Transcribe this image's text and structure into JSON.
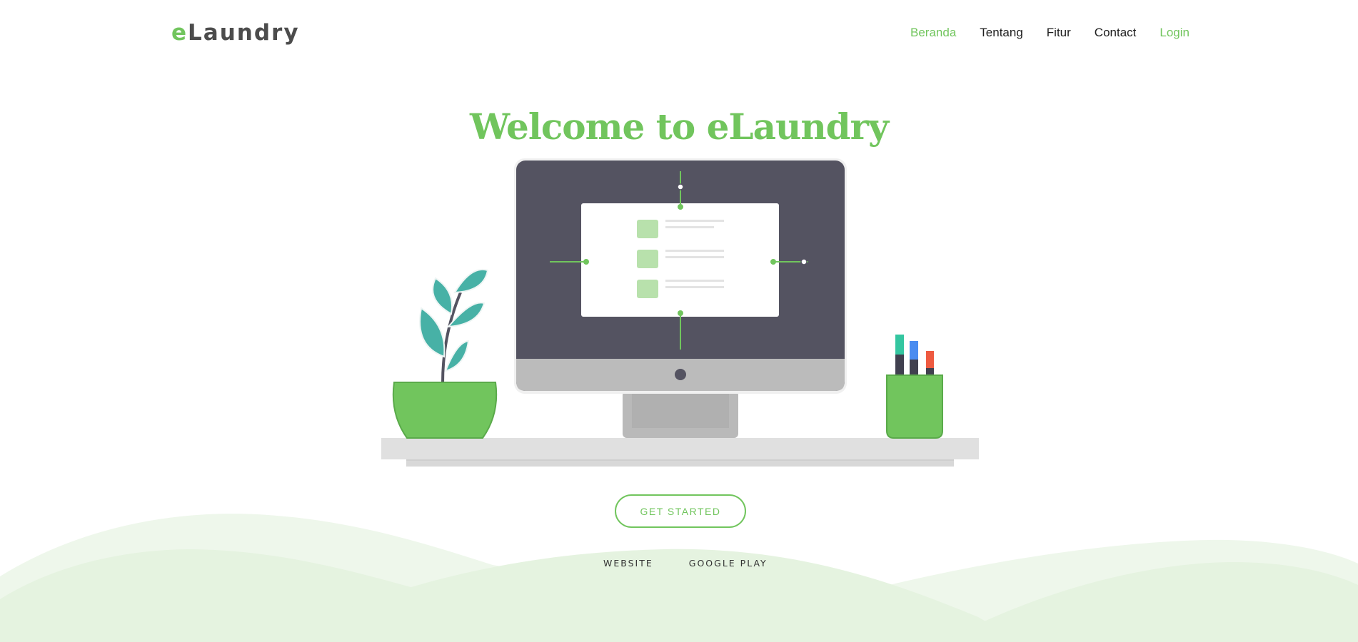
{
  "brand": {
    "logo_prefix": "e",
    "logo_rest": "Laundry"
  },
  "nav": {
    "items": [
      {
        "label": "Beranda",
        "active": true
      },
      {
        "label": "Tentang"
      },
      {
        "label": "Fitur"
      },
      {
        "label": "Contact"
      },
      {
        "label": "Login"
      }
    ]
  },
  "hero": {
    "title": "Welcome to eLaundry",
    "cta_label": "GET STARTED",
    "links": [
      "WEBSITE",
      "GOOGLE PLAY"
    ]
  },
  "colors": {
    "accent": "#71c55d",
    "text_dark": "#1e1e1e",
    "monitor_body": "#545361",
    "wave": "#e5f3e0"
  },
  "icons": [
    "monitor-illustration",
    "plant-illustration",
    "pen-cup-illustration"
  ]
}
